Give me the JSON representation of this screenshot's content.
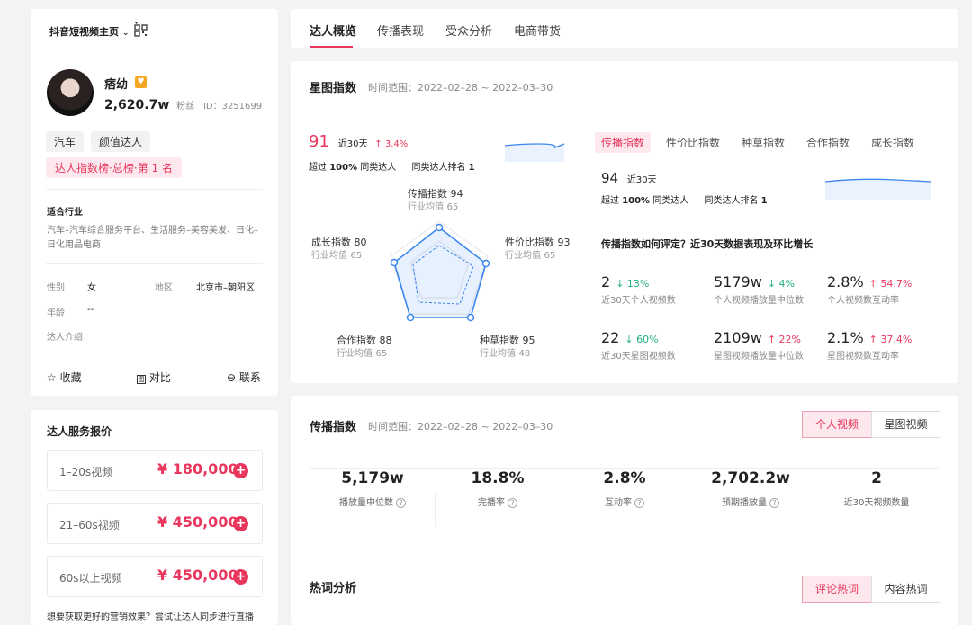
{
  "profile": {
    "platform_selector": "抖音短视频主页",
    "name": "痞幼",
    "fans": "2,620.7w",
    "fans_label": "粉丝",
    "id_text": "ID：3251699",
    "tags": [
      "汽车",
      "颜值达人"
    ],
    "rank_badge": "达人指数榜·总榜·第 1 名",
    "industry_title": "适合行业",
    "industry_text": "汽车–汽车综合服务平台、生活服务–美容美发、日化–日化用品电商",
    "gender_label": "性别",
    "gender_value": "女",
    "region_label": "地区",
    "region_value": "北京市–朝阳区",
    "age_label": "年龄",
    "age_value": "--",
    "intro_label": "达人介绍：",
    "actions": {
      "favorite": "收藏",
      "compare": "对比",
      "contact": "联系"
    }
  },
  "pricing": {
    "title": "达人服务报价",
    "items": [
      {
        "label": "1–20s视频",
        "price": "¥ 180,000"
      },
      {
        "label": "21–60s视频",
        "price": "¥ 450,000"
      },
      {
        "label": "60s以上视频",
        "price": "¥ 450,000"
      }
    ],
    "footer": "想要获取更好的营销效果？尝试让达人同步进行直播"
  },
  "tabs": [
    "达人概览",
    "传播表现",
    "受众分析",
    "电商带货"
  ],
  "star_index": {
    "title": "星图指数",
    "time_range": "时间范围：2022–02–28 ~ 2022–03–30",
    "score": "91",
    "period": "近30天",
    "change": "↑ 3.4%",
    "exceed_prefix": "超过",
    "exceed_value": "100%",
    "exceed_suffix": "同类达人",
    "rank_prefix": "同类达人排名",
    "rank_value": "1",
    "radar": {
      "spread": {
        "name": "传播指数",
        "value": "94",
        "avg_label": "行业均值",
        "avg": "65"
      },
      "value": {
        "name": "性价比指数",
        "value": "93",
        "avg_label": "行业均值",
        "avg": "65"
      },
      "seed": {
        "name": "种草指数",
        "value": "95",
        "avg_label": "行业均值",
        "avg": "48"
      },
      "coop": {
        "name": "合作指数",
        "value": "88",
        "avg_label": "行业均值",
        "avg": "65"
      },
      "growth": {
        "name": "成长指数",
        "value": "80",
        "avg_label": "行业均值",
        "avg": "65"
      }
    },
    "sub_tabs": [
      "传播指数",
      "性价比指数",
      "种草指数",
      "合作指数",
      "成长指数"
    ],
    "sub_score": "94",
    "sub_period": "近30天",
    "sub_exceed_prefix": "超过",
    "sub_exceed_value": "100%",
    "sub_exceed_suffix": "同类达人",
    "sub_rank_prefix": "同类达人排名",
    "sub_rank_value": "1",
    "question": "传播指数如何评定？近30天数据表现及环比增长",
    "metrics": [
      {
        "num": "2",
        "chg": "↓ 13%",
        "dir": "down",
        "lbl": "近30天个人视频数"
      },
      {
        "num": "5179w",
        "chg": "↓ 4%",
        "dir": "down",
        "lbl": "个人视频播放量中位数"
      },
      {
        "num": "2.8%",
        "chg": "↑ 54.7%",
        "dir": "up",
        "lbl": "个人视频数互动率"
      },
      {
        "num": "22",
        "chg": "↓ 60%",
        "dir": "down",
        "lbl": "近30天星图视频数"
      },
      {
        "num": "2109w",
        "chg": "↑ 22%",
        "dir": "up",
        "lbl": "星图视频播放量中位数"
      },
      {
        "num": "2.1%",
        "chg": "↑ 37.4%",
        "dir": "up",
        "lbl": "星图视频数互动率"
      }
    ]
  },
  "spread": {
    "title": "传播指数",
    "time_range": "时间范围：2022–02–28 ~ 2022–03–30",
    "toggle": [
      "个人视频",
      "星图视频"
    ],
    "stats": [
      {
        "num": "5,179w",
        "lbl": "播放量中位数"
      },
      {
        "num": "18.8%",
        "lbl": "完播率"
      },
      {
        "num": "2.8%",
        "lbl": "互动率"
      },
      {
        "num": "2,702.2w",
        "lbl": "预期播放量"
      },
      {
        "num": "2",
        "lbl": "近30天视频数量"
      }
    ]
  },
  "hotwords": {
    "title": "热词分析",
    "toggle": [
      "评论热词",
      "内容热词"
    ]
  },
  "colors": {
    "accent": "#e8365d",
    "chart_blue": "#3c86f0",
    "green": "#22b07d"
  }
}
